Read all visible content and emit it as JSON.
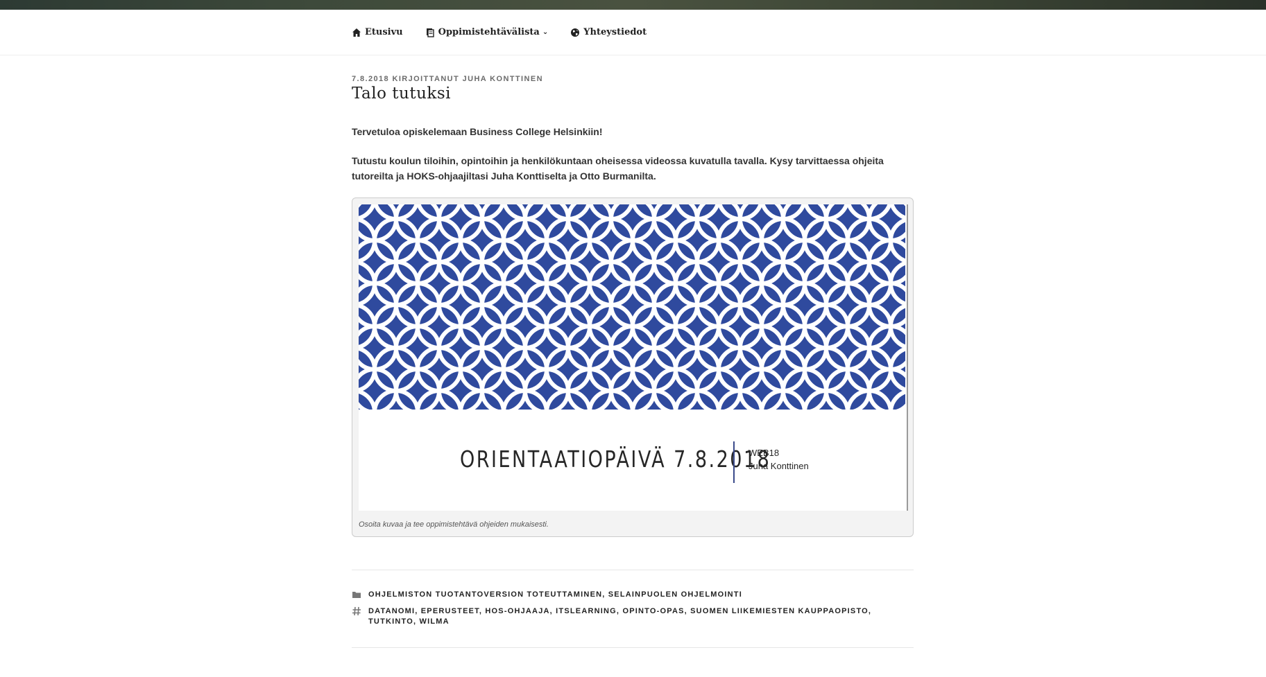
{
  "nav": {
    "items": [
      {
        "label": "Etusivu",
        "icon": "home-icon",
        "has_dropdown": false
      },
      {
        "label": "Oppimistehtävälista",
        "icon": "document-icon",
        "has_dropdown": true
      },
      {
        "label": "Yhteystiedot",
        "icon": "globe-icon",
        "has_dropdown": false
      }
    ]
  },
  "post": {
    "meta": "7.8.2018 KIRJOITTANUT JUHA KONTTINEN",
    "title": "Talo tutuksi",
    "paragraphs": [
      "Tervetuloa opiskelemaan Business College Helsinkiin!",
      "Tutustu koulun tiloihin, opintoihin ja henkilökuntaan oheisessa videossa kuvatulla tavalla. Kysy tarvittaessa ohjeita tutoreilta ja HOKS-ohjaajiltasi Juha Konttiselta ja Otto Burmanilta."
    ],
    "figure": {
      "slide_title": "ORIENTAATIOPÄIVÄ 7.8.2018",
      "slide_sub1": "WEB18",
      "slide_sub2": "Juha Konttinen",
      "caption": "Osoita kuvaa ja tee oppimistehtävä ohjeiden mukaisesti.",
      "pattern_color": "#2f4a9e"
    },
    "categories": "OHJELMISTON TUOTANTOVERSION TOTEUTTAMINEN, SELAINPUOLEN OHJELMOINTI",
    "tags": "DATANOMI, EPERUSTEET, HOS-OHJAAJA, ITSLEARNING, OPINTO-OPAS, SUOMEN LIIKEMIESTEN KAUPPAOPISTO, TUTKINTO, WILMA"
  }
}
